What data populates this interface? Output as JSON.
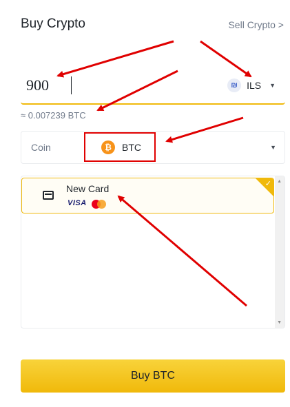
{
  "header": {
    "title": "Buy Crypto",
    "sell_link": "Sell Crypto >"
  },
  "amount": {
    "value": "900",
    "currency_icon": "shekel-icon",
    "currency_code": "ILS"
  },
  "conversion": {
    "text": "≈ 0.007239 BTC"
  },
  "coin": {
    "label": "Coin",
    "selected": "BTC",
    "icon": "bitcoin-icon"
  },
  "payment": {
    "card_label": "New Card",
    "brand_visa": "VISA",
    "brand_mastercard": "MasterCard"
  },
  "buy_button": {
    "label": "Buy BTC"
  },
  "colors": {
    "accent": "#f0b90b",
    "annotation": "#e00000",
    "bitcoin": "#f7931a"
  }
}
